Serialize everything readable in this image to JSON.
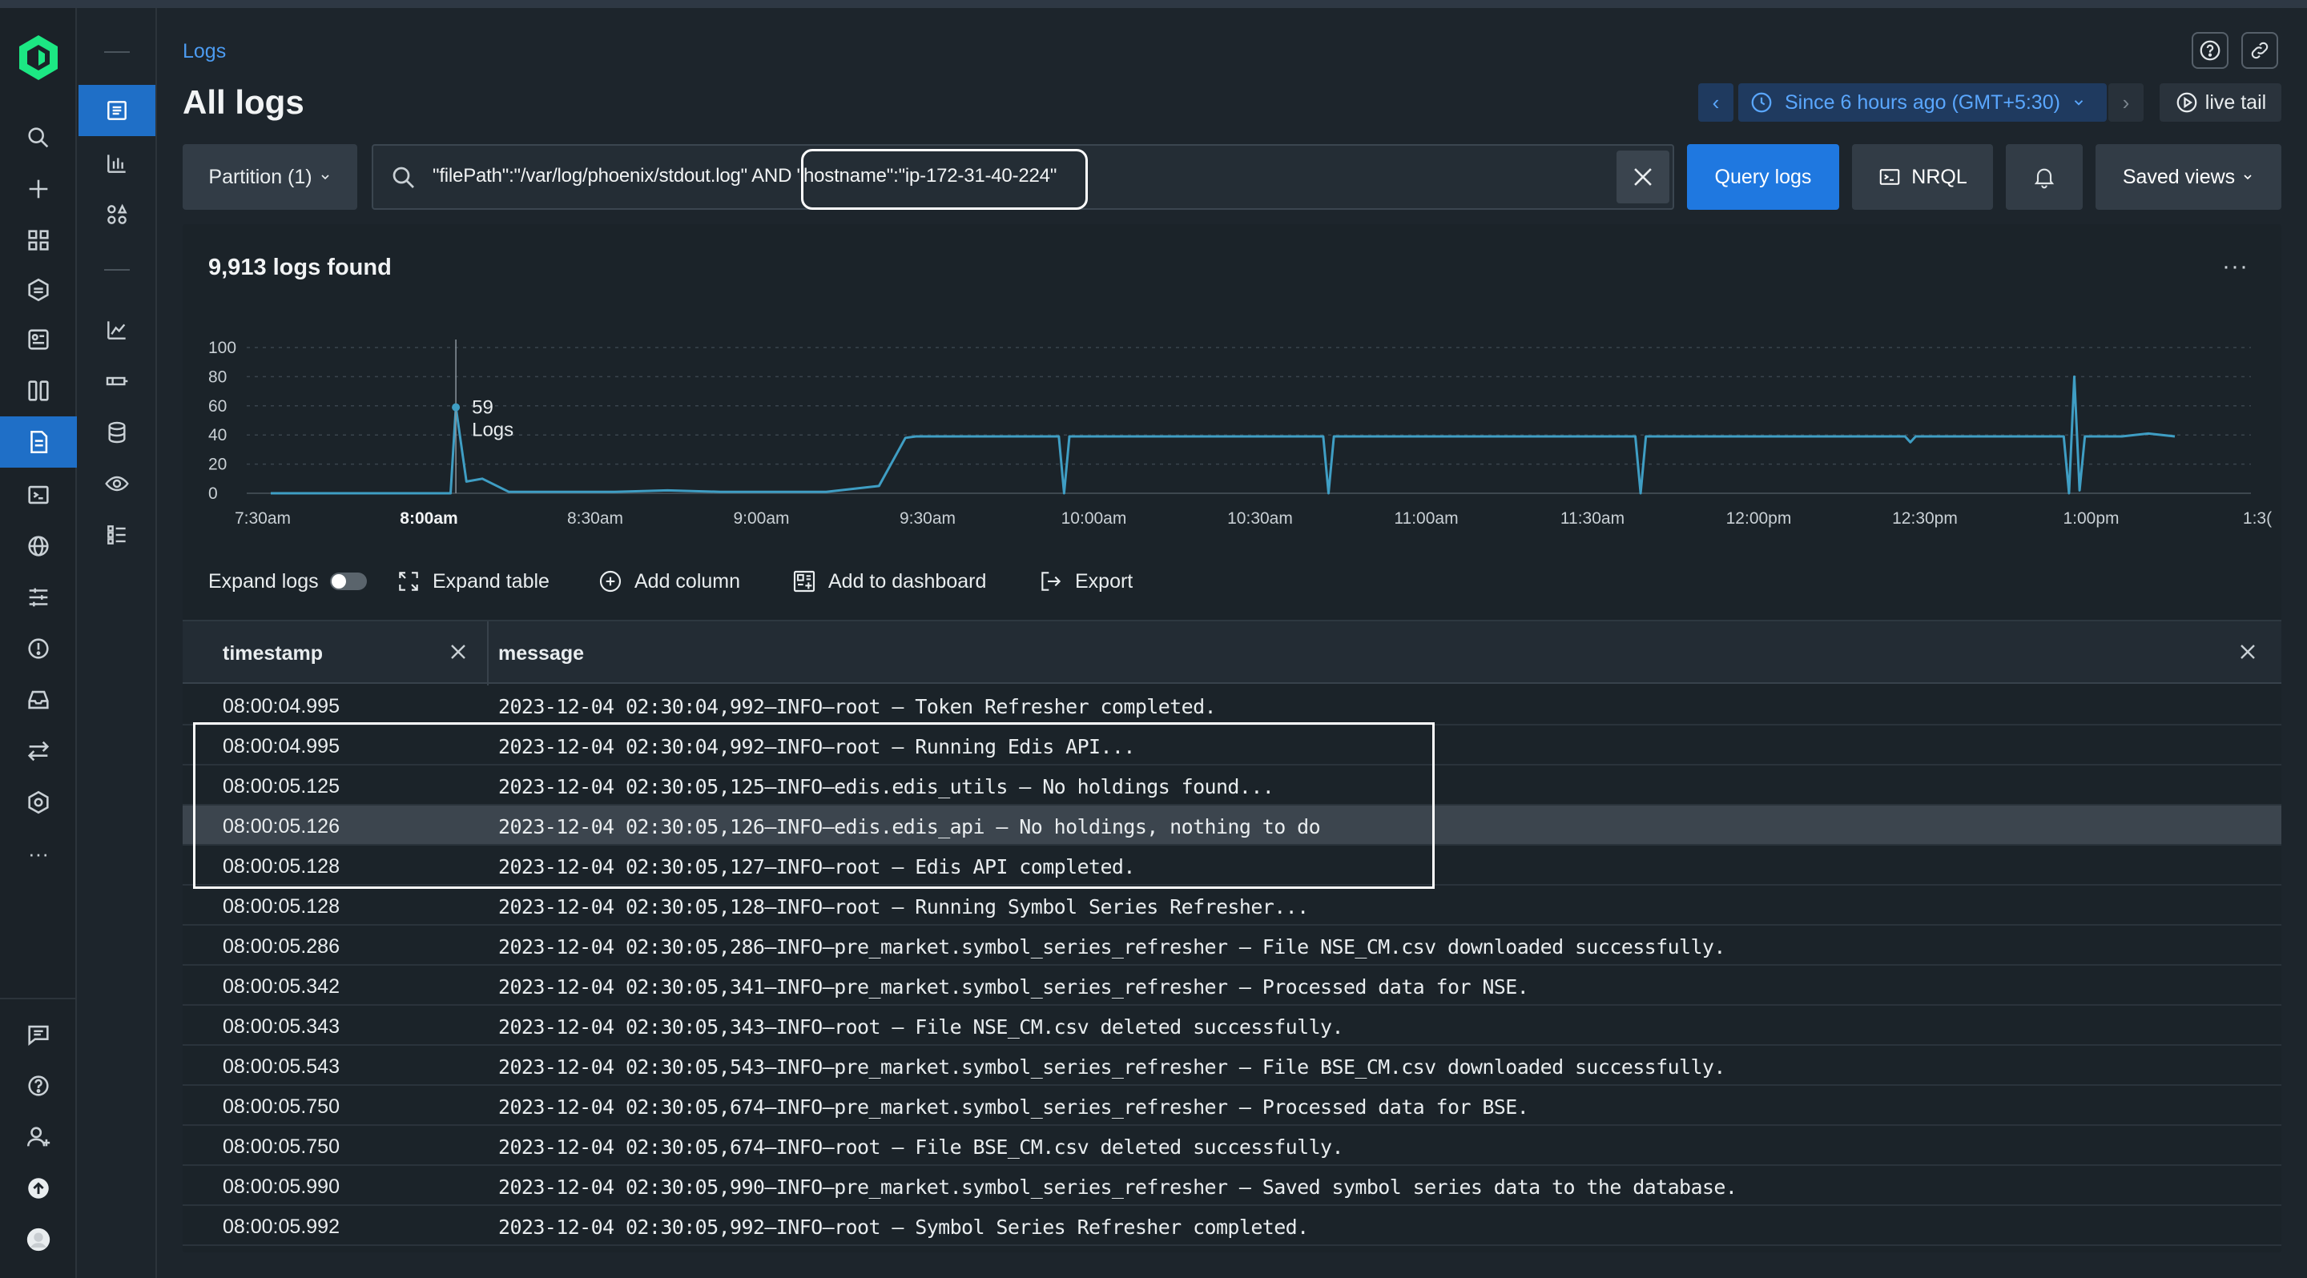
{
  "breadcrumb": "Logs",
  "title": "All logs",
  "time": {
    "range_label": "Since 6 hours ago (GMT+5:30)",
    "prev": "‹",
    "next": "›",
    "live_tail": "live tail"
  },
  "query_bar": {
    "partition": "Partition (1)",
    "query": "\"filePath\":\"/var/log/phoenix/stdout.log\" AND \"hostname\":\"ip-172-31-40-224\"",
    "query_logs": "Query logs",
    "nrql": "NRQL",
    "saved_views": "Saved views"
  },
  "summary": {
    "count": "9,913 logs found",
    "more": "···"
  },
  "chart_data": {
    "type": "line",
    "x": [
      "7:25am",
      "7:30am",
      "7:40am",
      "7:50am",
      "7:59am",
      "8:00am",
      "8:02am",
      "8:05am",
      "8:10am",
      "8:20am",
      "8:30am",
      "8:40am",
      "8:50am",
      "9:00am",
      "9:10am",
      "9:20am",
      "9:25am",
      "9:27am",
      "9:30am",
      "9:40am",
      "9:50am",
      "9:54am",
      "9:55am",
      "9:56am",
      "10:00am",
      "10:15am",
      "10:30am",
      "10:44am",
      "10:45am",
      "10:46am",
      "11:00am",
      "11:15am",
      "11:30am",
      "11:43am",
      "11:44am",
      "11:45am",
      "12:00pm",
      "12:15pm",
      "12:30pm",
      "12:34pm",
      "12:35pm",
      "12:36pm",
      "12:45pm",
      "1:00pm",
      "1:04pm",
      "1:05pm",
      "1:06pm",
      "1:07pm",
      "1:08pm",
      "1:15pm",
      "1:20pm",
      "1:25pm"
    ],
    "values": [
      0,
      0,
      0,
      0,
      0,
      59,
      8,
      10,
      1,
      1,
      1,
      2,
      1,
      1,
      1,
      5,
      38,
      39,
      39,
      39,
      39,
      39,
      0,
      39,
      39,
      39,
      39,
      39,
      0,
      39,
      39,
      39,
      39,
      39,
      0,
      39,
      39,
      39,
      39,
      39,
      35,
      39,
      39,
      39,
      39,
      0,
      80,
      2,
      39,
      39,
      41,
      39
    ],
    "yticks": [
      "100",
      "80",
      "60",
      "40",
      "20",
      "0"
    ],
    "ylim": [
      0,
      100
    ],
    "xticks": [
      "7:30am",
      "8:00am",
      "8:30am",
      "9:00am",
      "9:30am",
      "10:00am",
      "10:30am",
      "11:00am",
      "11:30am",
      "12:00pm",
      "12:30pm",
      "1:00pm",
      "1:3("
    ],
    "tooltip": {
      "value": "59",
      "label": "Logs"
    },
    "grid": true,
    "line_color": "#3f9ec4"
  },
  "toolbar": {
    "expand_logs": "Expand logs",
    "expand_table": "Expand table",
    "add_column": "Add column",
    "add_to_dashboard": "Add to dashboard",
    "export": "Export"
  },
  "table": {
    "columns": [
      "timestamp",
      "message"
    ],
    "rows": [
      {
        "ts": "08:00:04.995",
        "msg": "2023-12-04 02:30:04,992—INFO—root — Token Refresher completed."
      },
      {
        "ts": "08:00:04.995",
        "msg": "2023-12-04 02:30:04,992—INFO—root — Running Edis API..."
      },
      {
        "ts": "08:00:05.125",
        "msg": "2023-12-04 02:30:05,125—INFO—edis.edis_utils — No holdings found..."
      },
      {
        "ts": "08:00:05.126",
        "msg": "2023-12-04 02:30:05,126—INFO—edis.edis_api — No holdings, nothing to do"
      },
      {
        "ts": "08:00:05.128",
        "msg": "2023-12-04 02:30:05,127—INFO—root — Edis API completed."
      },
      {
        "ts": "08:00:05.128",
        "msg": "2023-12-04 02:30:05,128—INFO—root — Running Symbol Series Refresher..."
      },
      {
        "ts": "08:00:05.286",
        "msg": "2023-12-04 02:30:05,286—INFO—pre_market.symbol_series_refresher — File NSE_CM.csv downloaded successfully."
      },
      {
        "ts": "08:00:05.342",
        "msg": "2023-12-04 02:30:05,341—INFO—pre_market.symbol_series_refresher — Processed data for NSE."
      },
      {
        "ts": "08:00:05.343",
        "msg": "2023-12-04 02:30:05,343—INFO—root — File NSE_CM.csv deleted successfully."
      },
      {
        "ts": "08:00:05.543",
        "msg": "2023-12-04 02:30:05,543—INFO—pre_market.symbol_series_refresher — File BSE_CM.csv downloaded successfully."
      },
      {
        "ts": "08:00:05.750",
        "msg": "2023-12-04 02:30:05,674—INFO—pre_market.symbol_series_refresher — Processed data for BSE."
      },
      {
        "ts": "08:00:05.750",
        "msg": "2023-12-04 02:30:05,674—INFO—root — File BSE_CM.csv deleted successfully."
      },
      {
        "ts": "08:00:05.990",
        "msg": "2023-12-04 02:30:05,990—INFO—pre_market.symbol_series_refresher — Saved symbol series data to the database."
      },
      {
        "ts": "08:00:05.992",
        "msg": "2023-12-04 02:30:05,992—INFO—root — Symbol Series Refresher completed."
      }
    ]
  },
  "nav_icons": [
    "search-icon",
    "add-icon",
    "apps-grid-icon",
    "apm-icon",
    "browser-icon",
    "dashboards-icon",
    "logs-icon",
    "terminal-icon",
    "globe-icon",
    "settings-sliders-icon",
    "alerts-icon",
    "inbox-icon",
    "transfer-icon",
    "hexagon-icon",
    "more-icon",
    "feedback-icon",
    "help-icon",
    "add-user-icon",
    "upgrade-icon",
    "avatar"
  ],
  "more_label": "···",
  "colors": {
    "accent": "#1f78e0",
    "active_nav": "#1f6fc7",
    "link": "#4c9bf0",
    "line": "#3f9ec4"
  }
}
